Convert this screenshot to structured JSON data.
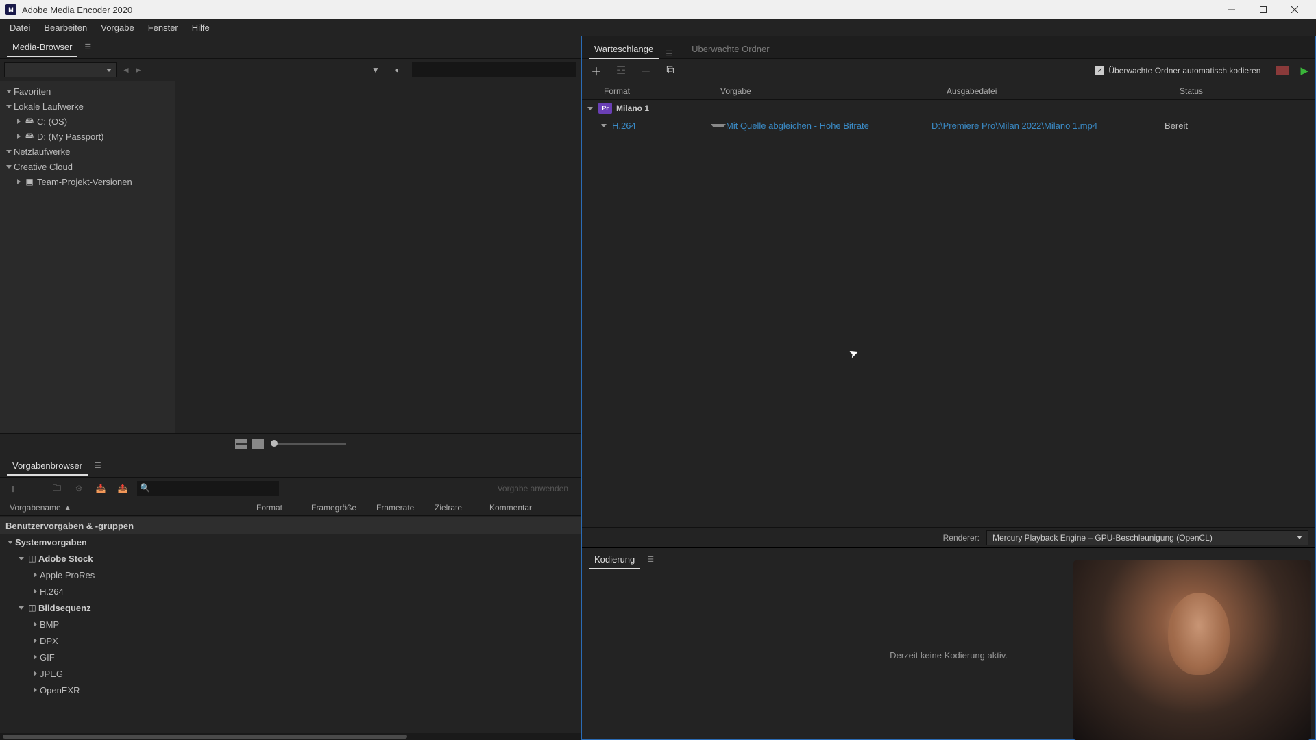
{
  "app": {
    "title": "Adobe Media Encoder 2020"
  },
  "menu": {
    "items": [
      "Datei",
      "Bearbeiten",
      "Vorgabe",
      "Fenster",
      "Hilfe"
    ]
  },
  "media_browser": {
    "title": "Media-Browser",
    "tree": {
      "favorites": "Favoriten",
      "local_drives": "Lokale Laufwerke",
      "drive_c": "C: (OS)",
      "drive_d": "D: (My Passport)",
      "network_drives": "Netzlaufwerke",
      "creative_cloud": "Creative Cloud",
      "team_projects": "Team-Projekt-Versionen"
    }
  },
  "preset_browser": {
    "title": "Vorgabenbrowser",
    "apply_label": "Vorgabe anwenden",
    "columns": {
      "name": "Vorgabename",
      "format": "Format",
      "framesize": "Framegröße",
      "framerate": "Framerate",
      "zielrate": "Zielrate",
      "kommentar": "Kommentar"
    },
    "groups": {
      "user": "Benutzervorgaben & -gruppen",
      "system": "Systemvorgaben",
      "adobe_stock": "Adobe Stock",
      "apple_prores": "Apple ProRes",
      "h264": "H.264",
      "image_seq": "Bildsequenz",
      "bmp": "BMP",
      "dpx": "DPX",
      "gif": "GIF",
      "jpeg": "JPEG",
      "openexr": "OpenEXR"
    }
  },
  "queue": {
    "tab_queue": "Warteschlange",
    "tab_watched": "Überwachte Ordner",
    "auto_encode_label": "Überwachte Ordner automatisch kodieren",
    "columns": {
      "format": "Format",
      "preset": "Vorgabe",
      "output": "Ausgabedatei",
      "status": "Status"
    },
    "job": {
      "name": "Milano 1",
      "format": "H.264",
      "preset": "Mit Quelle abgleichen - Hohe Bitrate",
      "output": "D:\\Premiere Pro\\Milan 2022\\Milano 1.mp4",
      "status": "Bereit"
    },
    "renderer_label": "Renderer:",
    "renderer_value": "Mercury Playback Engine – GPU-Beschleunigung (OpenCL)"
  },
  "encoding": {
    "title": "Kodierung",
    "idle_text": "Derzeit keine Kodierung aktiv."
  }
}
